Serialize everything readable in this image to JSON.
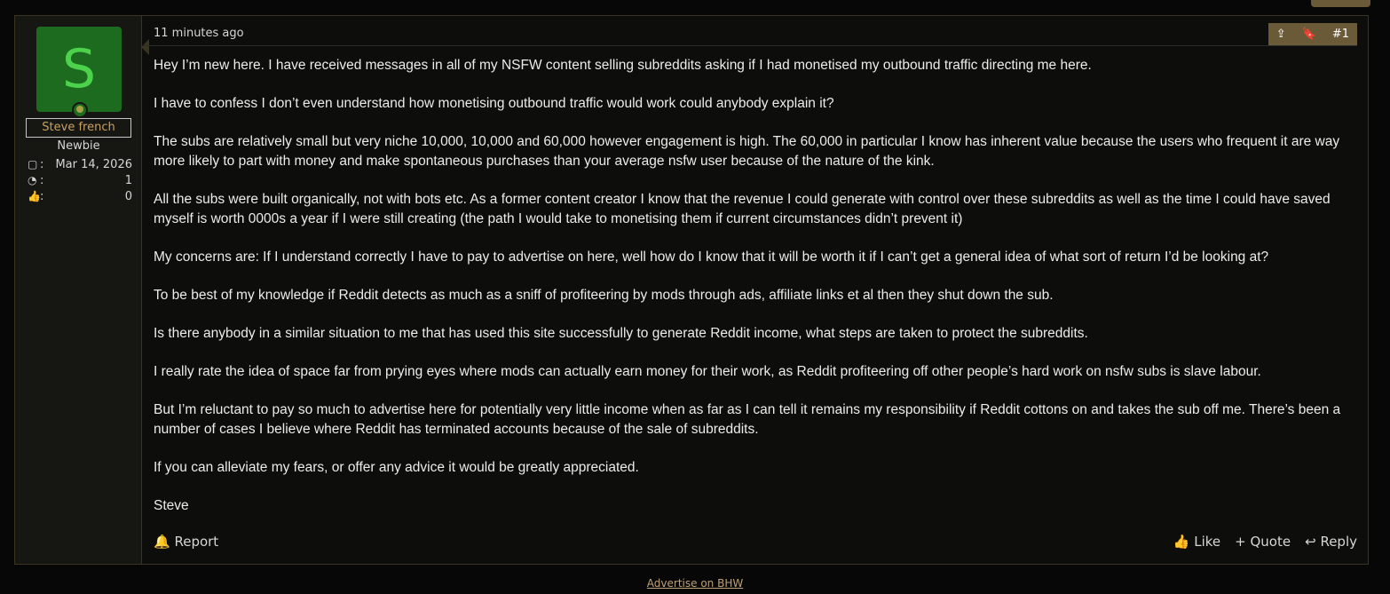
{
  "post": {
    "author": {
      "avatar_letter": "S",
      "username": "Steve french",
      "title": "Newbie",
      "stats": [
        {
          "icon": "calendar-icon",
          "value": "Mar 14, 2026"
        },
        {
          "icon": "messages-icon",
          "value": "1"
        },
        {
          "icon": "thumbs-up-icon",
          "value": "0"
        }
      ]
    },
    "meta": {
      "time": "11 minutes ago",
      "post_number": "#1",
      "share_icon": "share-icon",
      "bookmark_icon": "bookmark-icon"
    },
    "paragraphs": [
      {
        "text": "Hey I’m new here. I have received messages in all of my NSFW content selling subreddits asking if I had monetised my outbound traffic directing me here."
      },
      {
        "text": "I have to confess I don’t even understand how monetising outbound traffic would work could anybody explain it?"
      },
      {
        "text": "The subs are relatively small but very niche 10,000, 10,000 and 60,000 however engagement is high. The 60,000 in particular I know has inherent value because the users who frequent it are way more likely to part with money and make spontaneous purchases than your average nsfw user because of the nature of the kink."
      },
      {
        "text": "All the subs were built organically, not with bots etc. As a former content creator I know that the revenue I could generate with control over these subreddits as well as the time I could have saved myself is worth 0000s a year if I were still creating (the path I would take to monetising them if current circumstances didn’t prevent it)"
      },
      {
        "text": "My concerns are: If I understand correctly I have to pay to advertise on here, well how do I know that it will be worth it if I can’t get a general idea of what sort of return I’d be looking at?"
      },
      {
        "text": "To be best of my knowledge if Reddit detects as much as a sniff of profiteering by mods through ads, affiliate links et al then they shut down the sub."
      },
      {
        "text": "Is there anybody in a similar situation to me that has used this site successfully to generate Reddit income, what steps are taken to protect the subreddits."
      },
      {
        "text": "I really rate the idea of space far from prying eyes where mods can actually earn money for their work, as Reddit profiteering off other people’s hard work on nsfw subs is slave labour."
      },
      {
        "text": "But I’m reluctant to pay so much to advertise here for potentially very little income when as far as I can tell it remains my responsibility if Reddit cottons on and takes the sub off me. There’s been a number of cases I believe where Reddit has terminated accounts because of the sale of subreddits."
      },
      {
        "text": "If you can alleviate my fears, or offer any advice it would be greatly appreciated."
      },
      {
        "text": "Steve"
      }
    ],
    "footer": {
      "report": "Report",
      "like": "Like",
      "quote": "Quote",
      "reply": "Reply"
    }
  },
  "ad_link": "Advertise on BHW"
}
